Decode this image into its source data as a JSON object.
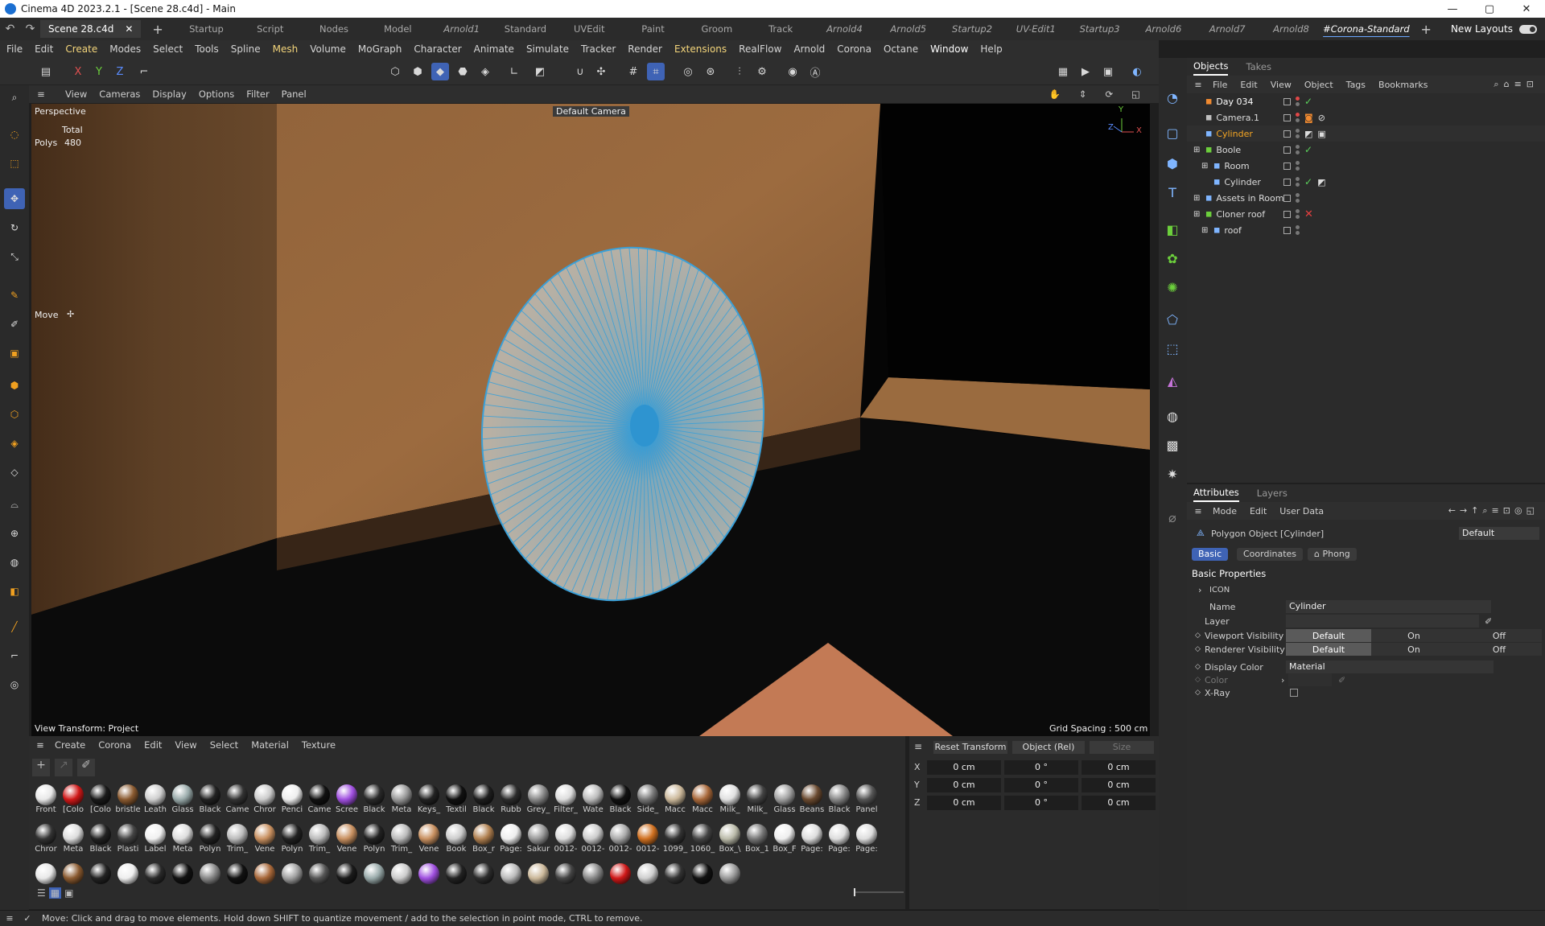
{
  "window": {
    "title": "Cinema 4D 2023.2.1 - [Scene 28.c4d] - Main",
    "min": "—",
    "max": "▢",
    "close": "✕"
  },
  "doc_tab": {
    "label": "Scene 28.c4d",
    "close": "✕",
    "plus": "+"
  },
  "layouts": [
    "Startup",
    "Script",
    "Nodes",
    "Model",
    "Arnold1",
    "Standard",
    "UVEdit",
    "Paint",
    "Groom",
    "Track",
    "Arnold4",
    "Arnold5",
    "Startup2",
    "UV-Edit1",
    "Startup3",
    "Arnold6",
    "Arnold7",
    "Arnold8",
    "#Corona-Standard"
  ],
  "layout_add": "+",
  "new_layouts": "New Layouts",
  "menu": [
    "File",
    "Edit",
    "Create",
    "Modes",
    "Select",
    "Tools",
    "Spline",
    "Mesh",
    "Volume",
    "MoGraph",
    "Character",
    "Animate",
    "Simulate",
    "Tracker",
    "Render",
    "Extensions",
    "RealFlow",
    "Arnold",
    "Corona",
    "Octane",
    "Window",
    "Help"
  ],
  "axis_lock": {
    "x": "X",
    "y": "Y",
    "z": "Z"
  },
  "viewport_menu": [
    "View",
    "Cameras",
    "Display",
    "Options",
    "Filter",
    "Panel"
  ],
  "viewport": {
    "projection": "Perspective",
    "stats_header": "Total",
    "polys_label": "Polys",
    "polys_value": "480",
    "camera": "Default Camera",
    "tool": "Move",
    "view_transform": "View Transform: Project",
    "grid_spacing": "Grid Spacing : 500 cm",
    "axis_labels": {
      "y": "Y",
      "z": "Z",
      "x": "X"
    }
  },
  "objects_tabs": [
    "Objects",
    "Takes"
  ],
  "objects_menu": [
    "File",
    "Edit",
    "View",
    "Object",
    "Tags",
    "Bookmarks"
  ],
  "objects": [
    {
      "name": "Day 034",
      "indent": 0,
      "color": "#ffffff",
      "status": "check"
    },
    {
      "name": "Camera.1",
      "indent": 0,
      "color": "#dcdcdc",
      "status": "none"
    },
    {
      "name": "Cylinder",
      "indent": 0,
      "color": "#f5a623",
      "status": "none"
    },
    {
      "name": "Boole",
      "indent": 0,
      "color": "#dcdcdc",
      "status": "check"
    },
    {
      "name": "Room",
      "indent": 1,
      "color": "#dcdcdc",
      "status": "none"
    },
    {
      "name": "Cylinder",
      "indent": 1,
      "color": "#dcdcdc",
      "status": "check"
    },
    {
      "name": "Assets in Room",
      "indent": 0,
      "color": "#dcdcdc",
      "status": "none"
    },
    {
      "name": "Cloner roof",
      "indent": 0,
      "color": "#dcdcdc",
      "status": "x"
    },
    {
      "name": "roof",
      "indent": 1,
      "color": "#dcdcdc",
      "status": "none"
    }
  ],
  "attributes_tabs": [
    "Attributes",
    "Layers"
  ],
  "attributes_menu": [
    "Mode",
    "Edit",
    "User Data"
  ],
  "attributes": {
    "object_title": "Polygon Object [Cylinder]",
    "preset": "Default",
    "tabs": [
      "Basic",
      "Coordinates",
      "Phong"
    ],
    "section": "Basic Properties",
    "icon_group": "ICON",
    "name_label": "Name",
    "name_value": "Cylinder",
    "layer_label": "Layer",
    "viewport_vis_label": "Viewport Visibility",
    "renderer_vis_label": "Renderer Visibility",
    "vis_options": [
      "Default",
      "On",
      "Off"
    ],
    "display_color_label": "Display Color",
    "display_color_value": "Material",
    "color_label": "Color",
    "xray_label": "X-Ray"
  },
  "material_menu": [
    "Create",
    "Corona",
    "Edit",
    "View",
    "Select",
    "Material",
    "Texture"
  ],
  "materials_row1": [
    "Front",
    "[Colo",
    "[Colo",
    "bristle",
    "Leath",
    "Glass",
    "Black",
    "Came",
    "Chror",
    "Penci",
    "Came",
    "Scree",
    "Black",
    "Meta",
    "Keys_",
    "Textil",
    "Black",
    "Rubb",
    "Grey_",
    "Filter_",
    "Wate",
    "Black",
    "Side_",
    "Macc",
    "Macc",
    "Milk_",
    "Milk_",
    "Glass",
    "Beans",
    "Black",
    "Panel"
  ],
  "materials_row2": [
    "Chror",
    "Meta",
    "Black",
    "Plasti",
    "Label",
    "Meta",
    "Polyn",
    "Trim_",
    "Vene",
    "Polyn",
    "Trim_",
    "Vene",
    "Polyn",
    "Trim_",
    "Vene",
    "Book",
    "Box_r",
    "Page:",
    "Sakur",
    "0012-",
    "0012-",
    "0012-",
    "0012-",
    "1099_",
    "1060_",
    "Box_\\",
    "Box_1",
    "Box_F",
    "Page:",
    "Page:",
    "Page:"
  ],
  "coords": {
    "reset": "Reset Transform",
    "mode": "Object (Rel)",
    "size": "Size",
    "rows": [
      {
        "axis": "X",
        "pos": "0 cm",
        "rot": "0 °",
        "scale": "0 cm"
      },
      {
        "axis": "Y",
        "pos": "0 cm",
        "rot": "0 °",
        "scale": "0 cm"
      },
      {
        "axis": "Z",
        "pos": "0 cm",
        "rot": "0 °",
        "scale": "0 cm"
      }
    ]
  },
  "status": "Move: Click and drag to move elements. Hold down SHIFT to quantize movement / add to the selection in point mode, CTRL to remove.",
  "colors": {
    "accent": "#3f63b5",
    "selected_object": "#f5a623",
    "mesh_wire": "#3aa0d8"
  }
}
